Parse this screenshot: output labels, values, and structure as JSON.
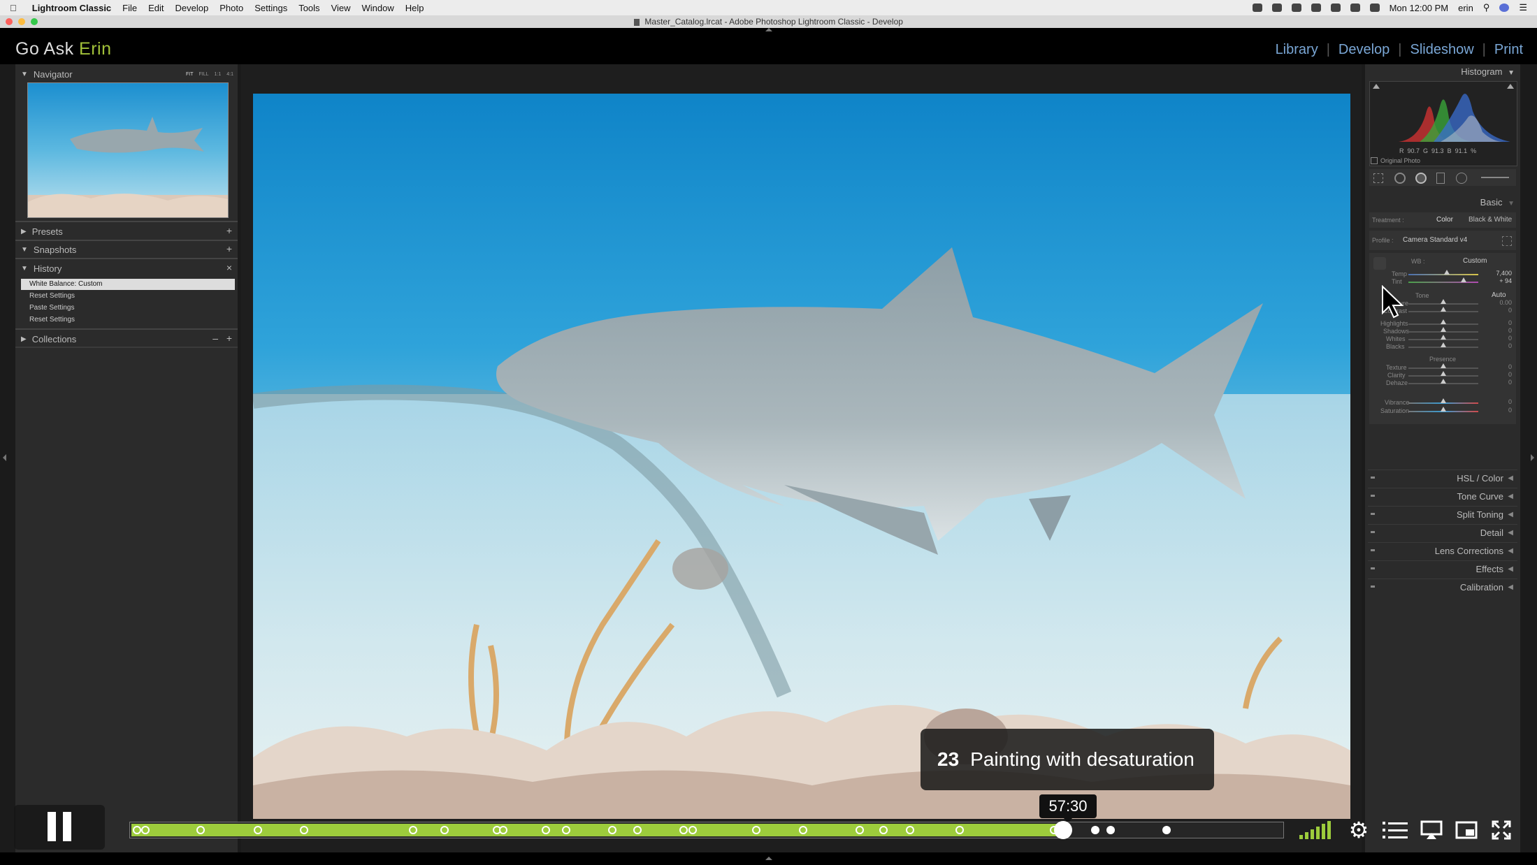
{
  "menubar": {
    "app_name": "Lightroom Classic",
    "items": [
      "File",
      "Edit",
      "Develop",
      "Photo",
      "Settings",
      "Tools",
      "View",
      "Window",
      "Help"
    ],
    "clock": "Mon 12:00 PM",
    "user": "erin"
  },
  "window": {
    "title": "Master_Catalog.lrcat - Adobe Photoshop Lightroom Classic - Develop"
  },
  "header": {
    "brand_main": "Go Ask",
    "brand_accent": "Erin",
    "modules": [
      "Library",
      "Develop",
      "Slideshow",
      "Print"
    ]
  },
  "left_panel": {
    "navigator": {
      "label": "Navigator",
      "zoom_options": [
        "FIT",
        "FILL",
        "1:1",
        "4:1"
      ]
    },
    "presets": {
      "label": "Presets"
    },
    "snapshots": {
      "label": "Snapshots"
    },
    "history": {
      "label": "History",
      "items": [
        "White Balance: Custom",
        "Reset Settings",
        "Paste Settings",
        "Reset Settings"
      ]
    },
    "collections": {
      "label": "Collections"
    }
  },
  "right_panel": {
    "histogram": {
      "label": "Histogram",
      "r_label": "R",
      "r": "90.7",
      "g_label": "G",
      "g": "91.3",
      "b_label": "B",
      "b": "91.1",
      "unit": "%"
    },
    "original_photo": "Original Photo",
    "basic": {
      "label": "Basic",
      "treatment_label": "Treatment :",
      "treatment_color": "Color",
      "treatment_bw": "Black & White",
      "profile_label": "Profile :",
      "profile_value": "Camera Standard v4",
      "wb_label": "WB :",
      "wb_value": "Custom",
      "temp_label": "Temp",
      "temp_value": "7,400",
      "tint_label": "Tint",
      "tint_value": "+ 94",
      "tone_label": "Tone",
      "auto_label": "Auto",
      "exposure_label": "Exposure",
      "exposure_value": "0.00",
      "contrast_label": "Contrast",
      "highlights_label": "Highlights",
      "shadows_label": "Shadows",
      "whites_label": "Whites",
      "blacks_label": "Blacks",
      "presence_label": "Presence",
      "texture_label": "Texture",
      "clarity_label": "Clarity",
      "dehaze_label": "Dehaze",
      "vibrance_label": "Vibrance",
      "saturation_label": "Saturation",
      "zero": "0"
    },
    "sections": [
      "HSL / Color",
      "Tone Curve",
      "Split Toning",
      "Detail",
      "Lens Corrections",
      "Effects",
      "Calibration"
    ]
  },
  "video": {
    "chapter_number": "23",
    "chapter_title": "Painting with desaturation",
    "time": "57:30",
    "progress_fraction": 0.81,
    "chapter_marks": [
      0.005,
      0.012,
      0.06,
      0.11,
      0.15,
      0.245,
      0.272,
      0.318,
      0.323,
      0.36,
      0.378,
      0.418,
      0.44,
      0.48,
      0.488,
      0.543,
      0.584,
      0.633,
      0.654,
      0.677,
      0.72,
      0.802,
      0.838,
      0.851,
      0.9
    ]
  },
  "colors": {
    "accent_green": "#9dcc3c",
    "module_blue": "#7aa7d6",
    "brand_green": "#a2c13a"
  }
}
